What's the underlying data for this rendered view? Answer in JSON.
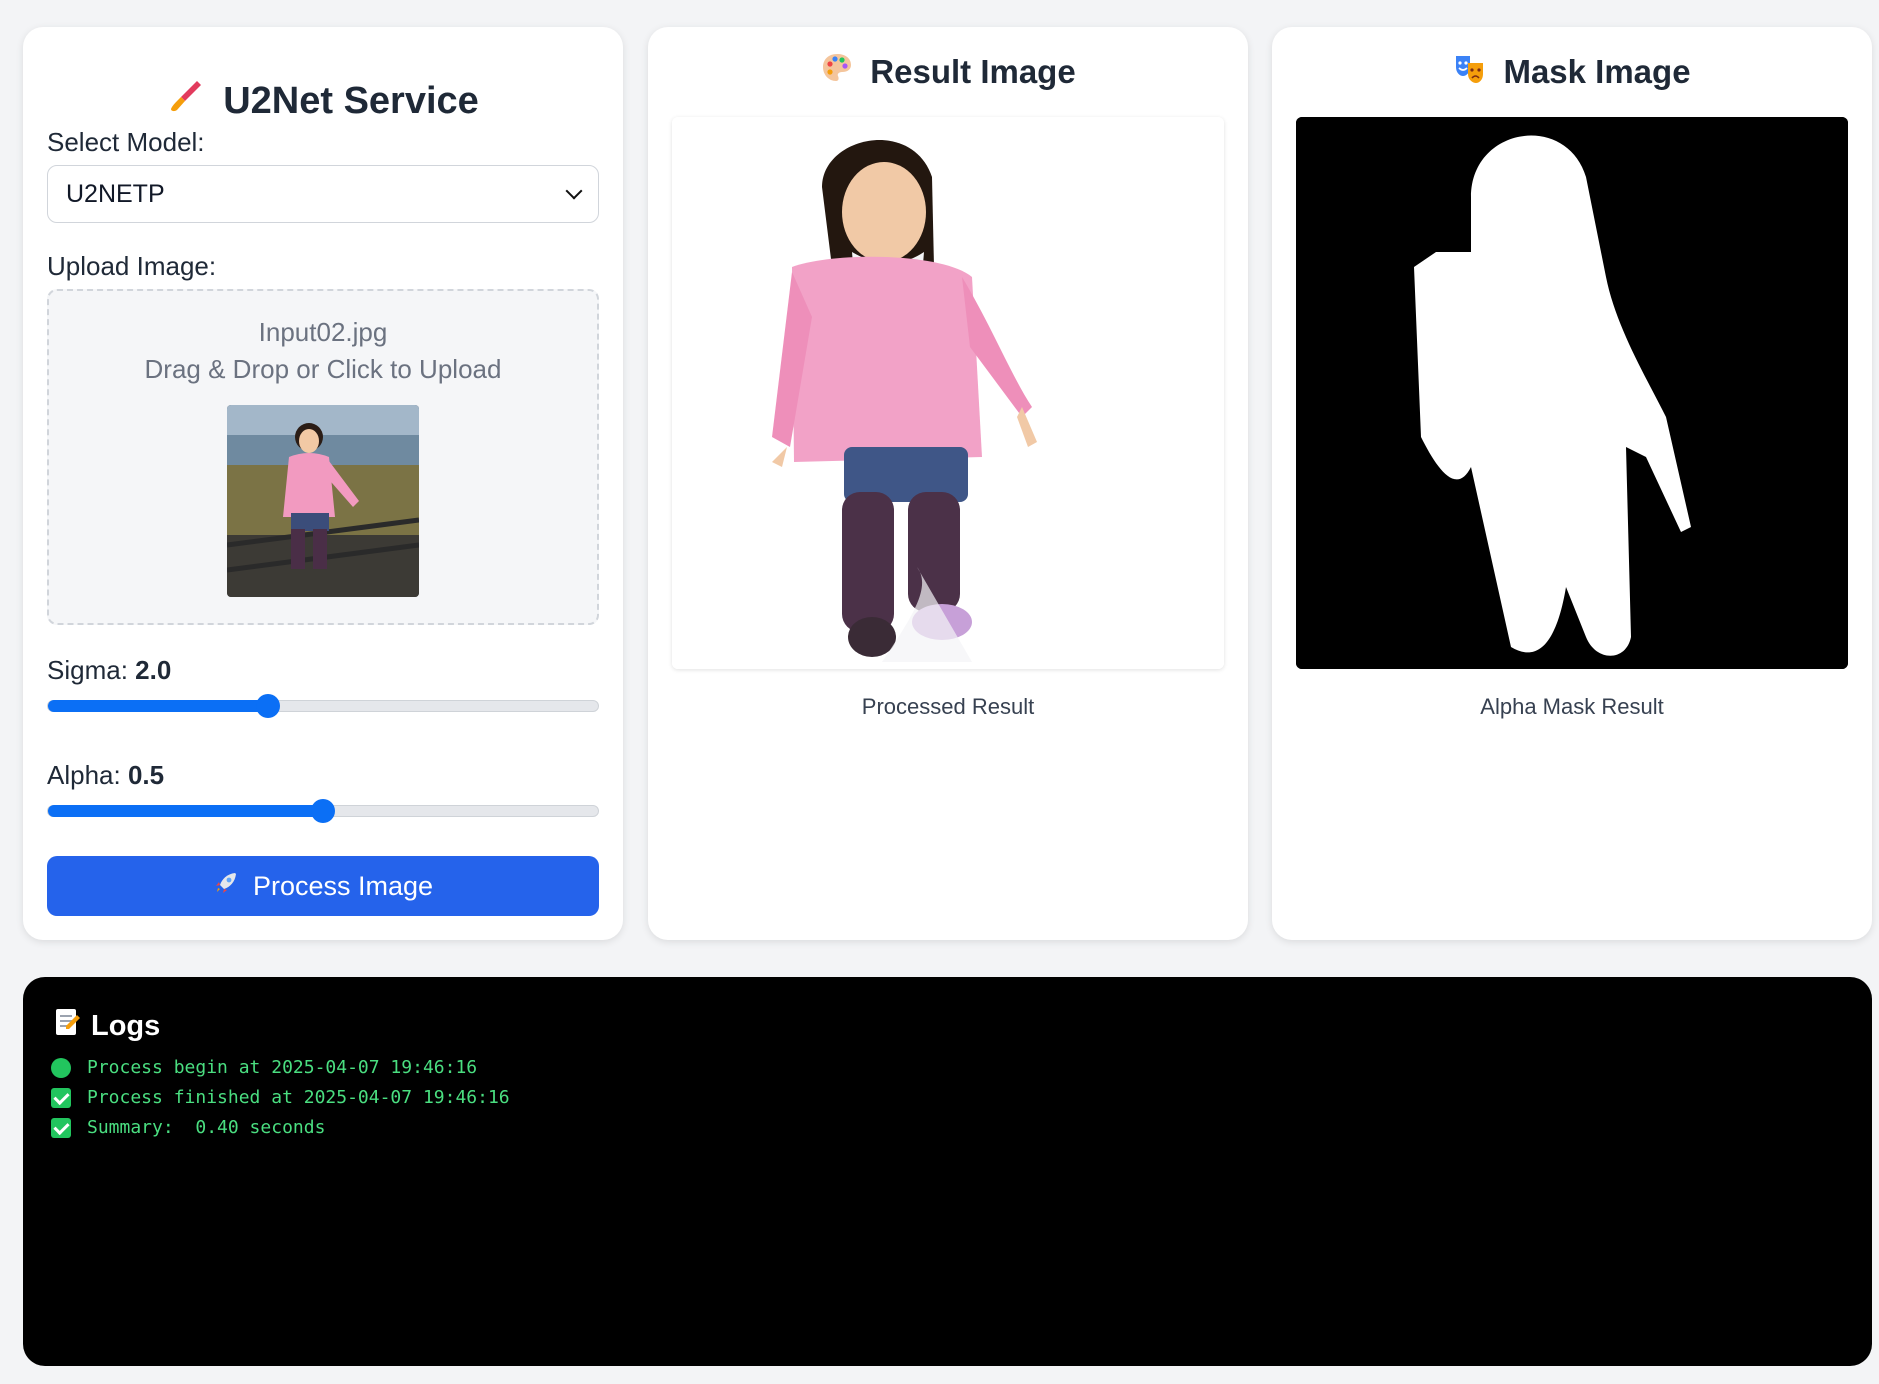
{
  "control": {
    "title": "U2Net Service",
    "title_icon": "paintbrush-icon",
    "model_label": "Select Model:",
    "model_value": "U2NETP",
    "upload_label": "Upload Image:",
    "upload_filename": "Input02.jpg",
    "upload_hint": "Drag & Drop or Click to Upload",
    "sigma_label": "Sigma:",
    "sigma_value": "2.0",
    "sigma_fraction": 0.4,
    "alpha_label": "Alpha:",
    "alpha_value": "0.5",
    "alpha_fraction": 0.5,
    "process_button": "Process Image",
    "process_icon": "rocket-icon",
    "accent_color": "#2563eb",
    "slider_color": "#0b6ff5"
  },
  "result": {
    "title": "Result Image",
    "title_icon": "palette-icon",
    "caption": "Processed Result"
  },
  "mask": {
    "title": "Mask Image",
    "title_icon": "theater-masks-icon",
    "caption": "Alpha Mask Result"
  },
  "logs": {
    "title": "Logs",
    "title_icon": "memo-icon",
    "lines": [
      {
        "icon": "green-circle-icon",
        "text": "Process begin at 2025-04-07 19:46:16"
      },
      {
        "icon": "check-box-icon",
        "text": "Process finished at 2025-04-07 19:46:16"
      },
      {
        "icon": "check-box-icon",
        "text": "Summary:  0.40 seconds"
      }
    ],
    "text_color": "#4ade80"
  }
}
